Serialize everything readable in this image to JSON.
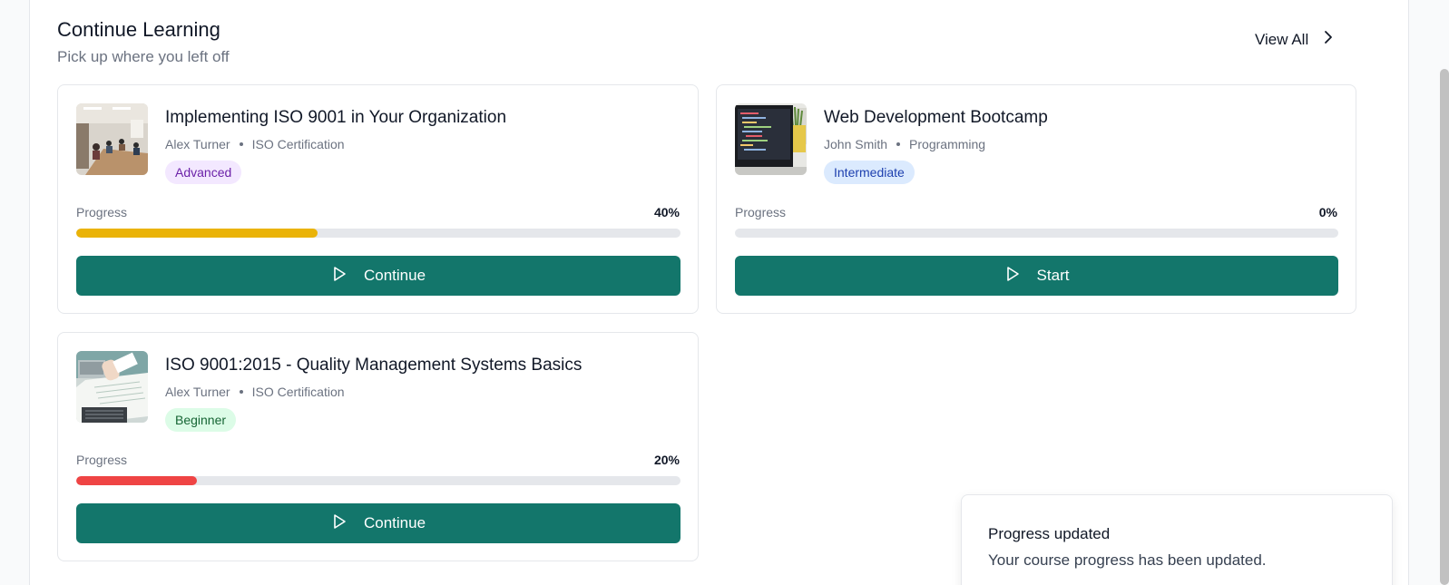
{
  "section": {
    "title": "Continue Learning",
    "subtitle": "Pick up where you left off",
    "view_all": "View All"
  },
  "progress_label": "Progress",
  "courses": [
    {
      "title": "Implementing ISO 9001 in Your Organization",
      "instructor": "Alex Turner",
      "category": "ISO Certification",
      "level": "Advanced",
      "level_color": "#6b21a8",
      "level_bg": "#f3e8ff",
      "progress_text": "40%",
      "progress": 0.4,
      "progress_color": "#eab308",
      "button_label": "Continue",
      "thumbnail_icon": "meeting-room-photo"
    },
    {
      "title": "Web Development Bootcamp",
      "instructor": "John Smith",
      "category": "Programming",
      "level": "Intermediate",
      "level_color": "#1e40af",
      "level_bg": "#dbeafe",
      "progress_text": "0%",
      "progress": 0.0,
      "progress_color": "#13766b",
      "button_label": "Start",
      "thumbnail_icon": "laptop-code-photo"
    },
    {
      "title": "ISO 9001:2015 - Quality Management Systems Basics",
      "instructor": "Alex Turner",
      "category": "ISO Certification",
      "level": "Beginner",
      "level_color": "#166534",
      "level_bg": "#dcfce7",
      "progress_text": "20%",
      "progress": 0.2,
      "progress_color": "#ef4444",
      "button_label": "Continue",
      "thumbnail_icon": "documents-desk-photo"
    }
  ],
  "toast": {
    "title": "Progress updated",
    "description": "Your course progress has been updated."
  },
  "colors": {
    "primary": "#13766b"
  }
}
